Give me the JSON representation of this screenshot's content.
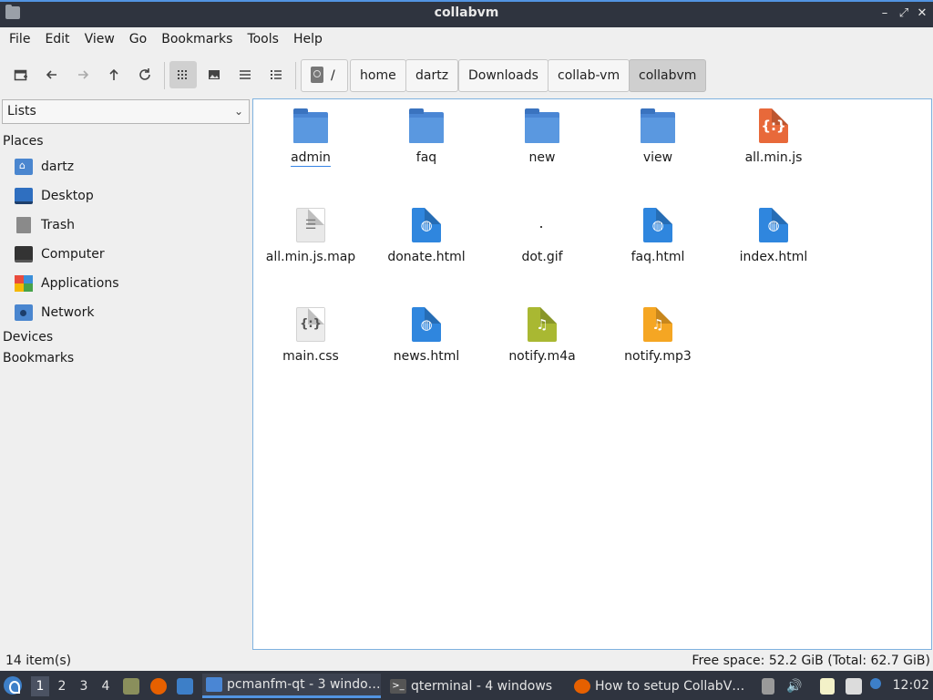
{
  "window": {
    "title": "collabvm"
  },
  "menu": [
    "File",
    "Edit",
    "View",
    "Go",
    "Bookmarks",
    "Tools",
    "Help"
  ],
  "breadcrumb": [
    "/",
    "home",
    "dartz",
    "Downloads",
    "collab-vm",
    "collabvm"
  ],
  "sidebar": {
    "selector": "Lists",
    "places_label": "Places",
    "places": [
      "dartz",
      "Desktop",
      "Trash",
      "Computer",
      "Applications",
      "Network"
    ],
    "devices_label": "Devices",
    "bookmarks_label": "Bookmarks"
  },
  "files": [
    {
      "name": "admin",
      "type": "folder"
    },
    {
      "name": "faq",
      "type": "folder"
    },
    {
      "name": "new",
      "type": "folder"
    },
    {
      "name": "view",
      "type": "folder"
    },
    {
      "name": "all.min.js",
      "type": "js"
    },
    {
      "name": "all.min.js.map",
      "type": "text"
    },
    {
      "name": "donate.html",
      "type": "html"
    },
    {
      "name": "dot.gif",
      "type": "image"
    },
    {
      "name": "faq.html",
      "type": "html"
    },
    {
      "name": "index.html",
      "type": "html"
    },
    {
      "name": "main.css",
      "type": "css"
    },
    {
      "name": "news.html",
      "type": "html"
    },
    {
      "name": "notify.m4a",
      "type": "audio"
    },
    {
      "name": "notify.mp3",
      "type": "audio"
    }
  ],
  "status": {
    "items": "14 item(s)",
    "free_space": "Free space: 52.2 GiB (Total: 62.7 GiB)"
  },
  "taskbar": {
    "workspaces": [
      "1",
      "2",
      "3",
      "4"
    ],
    "tasks": [
      "pcmanfm-qt - 3 windo…",
      "qterminal - 4 windows",
      "How to setup CollabV…"
    ],
    "clock": "12:02"
  },
  "colors": {
    "accent": "#5294e2",
    "folder": "#4a86d4",
    "panel": "#2f343f"
  }
}
